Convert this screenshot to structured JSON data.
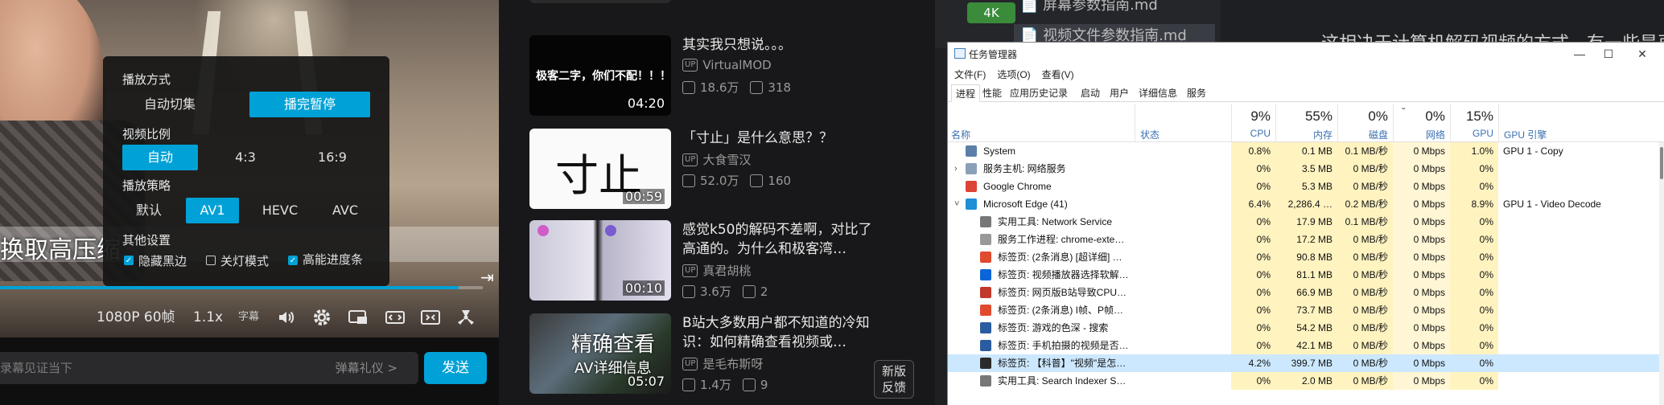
{
  "player": {
    "caption": "换取高压缩",
    "progress": 0.95,
    "controls": {
      "quality": "1080P 60帧",
      "speed": "1.1x",
      "subtitle": "字幕"
    },
    "danmaku": {
      "placeholder": "录幕见证当下",
      "etiquette": "弹幕礼仪 >",
      "send": "发送"
    },
    "settings": {
      "mode_title": "播放方式",
      "mode_options": [
        "自动切集",
        "播完暂停"
      ],
      "mode_selected": "播完暂停",
      "ratio_title": "视频比例",
      "ratio_options": [
        "自动",
        "4:3",
        "16:9"
      ],
      "ratio_selected": "自动",
      "strategy_title": "播放策略",
      "strategy_options": [
        "默认",
        "AV1",
        "HEVC",
        "AVC"
      ],
      "strategy_selected": "AV1",
      "other_title": "其他设置",
      "checks": [
        {
          "label": "隐藏黑边",
          "checked": true
        },
        {
          "label": "关灯模式",
          "checked": false
        },
        {
          "label": "高能进度条",
          "checked": true
        }
      ]
    }
  },
  "recommendations": [
    {
      "title": "其实我只想说。。。",
      "up": "VirtualMOD",
      "views": "18.6万",
      "danmaku": "318",
      "duration": "04:20",
      "thumb_text": "极客二字，你们不配！！！"
    },
    {
      "title": "「寸止」是什么意思？？",
      "up": "大食雪汉",
      "views": "52.0万",
      "danmaku": "160",
      "duration": "00:59",
      "thumb_text": "寸止"
    },
    {
      "title": "感觉k50的解码不差啊，对比了高通的。为什么和极客湾…",
      "up": "真君胡桃",
      "views": "3.6万",
      "danmaku": "2",
      "duration": "00:10",
      "thumb_text": ""
    },
    {
      "title": "B站大多数用户都不知道的冷知识：如何精确查看视频或…",
      "up": "是毛布斯呀",
      "views": "1.4万",
      "danmaku": "9",
      "duration": "05:07",
      "thumb_text": "精确查看",
      "thumb_sub": "AV详细信息"
    }
  ],
  "up_tag": "UP",
  "feedback": [
    "新版",
    "反馈"
  ],
  "editor": {
    "badge": "4K",
    "files": [
      "屏幕参数指南.md",
      "视频文件参数指南.md"
    ],
    "doc_text": "这相决于计算机解码视频的方式，有一些是再"
  },
  "task_manager": {
    "title": "任务管理器",
    "window_buttons": [
      "—",
      "☐",
      "✕"
    ],
    "menu": [
      "文件(F)",
      "选项(O)",
      "查看(V)"
    ],
    "tabs": [
      "进程",
      "性能",
      "应用历史记录",
      "启动",
      "用户",
      "详细信息",
      "服务"
    ],
    "active_tab": "进程",
    "header": {
      "name": "名称",
      "status": "状态",
      "cpu_pct": "9%",
      "cpu": "CPU",
      "mem_pct": "55%",
      "mem": "内存",
      "disk_pct": "0%",
      "disk": "磁盘",
      "net_pct": "0%",
      "net": "网络",
      "gpu_pct": "15%",
      "gpu": "GPU",
      "gpu_engine": "GPU 引擎",
      "sort_arrow": "ˇ"
    },
    "rows": [
      {
        "name": "System",
        "cpu": "0.8%",
        "mem": "0.1 MB",
        "disk": "0.1 MB/秒",
        "net": "0 Mbps",
        "gpu": "1.0%",
        "engine": "GPU 1 - Copy",
        "indent": 0,
        "expand": "",
        "icon": "system-icon",
        "icolor": "#5b7fa8"
      },
      {
        "name": "服务主机: 网络服务",
        "cpu": "0%",
        "mem": "3.5 MB",
        "disk": "0 MB/秒",
        "net": "0 Mbps",
        "gpu": "0%",
        "engine": "",
        "indent": 0,
        "expand": "›",
        "icon": "service-host-icon",
        "icolor": "#8aa0b8"
      },
      {
        "name": "Google Chrome",
        "cpu": "0%",
        "mem": "5.3 MB",
        "disk": "0 MB/秒",
        "net": "0 Mbps",
        "gpu": "0%",
        "engine": "",
        "indent": 0,
        "expand": "",
        "icon": "chrome-icon",
        "icolor": "#db4437"
      },
      {
        "name": "Microsoft Edge (41)",
        "cpu": "6.4%",
        "mem": "2,286.4 …",
        "disk": "0.2 MB/秒",
        "net": "0 Mbps",
        "gpu": "8.9%",
        "engine": "GPU 1 - Video Decode",
        "indent": 0,
        "expand": "˅",
        "icon": "edge-icon",
        "icolor": "#1e8fd6"
      },
      {
        "name": "实用工具: Network Service",
        "cpu": "0%",
        "mem": "17.9 MB",
        "disk": "0.1 MB/秒",
        "net": "0 Mbps",
        "gpu": "0%",
        "engine": "",
        "indent": 1,
        "expand": "",
        "icon": "utility-icon",
        "icolor": "#777"
      },
      {
        "name": "服务工作进程: chrome-exte…",
        "cpu": "0%",
        "mem": "17.2 MB",
        "disk": "0 MB/秒",
        "net": "0 Mbps",
        "gpu": "0%",
        "engine": "",
        "indent": 1,
        "expand": "",
        "icon": "document-icon",
        "icolor": "#999"
      },
      {
        "name": "标签页: (2条消息) [超详细] …",
        "cpu": "0%",
        "mem": "90.8 MB",
        "disk": "0 MB/秒",
        "net": "0 Mbps",
        "gpu": "0%",
        "engine": "",
        "indent": 1,
        "expand": "",
        "icon": "csdn-icon",
        "icolor": "#e04a2f"
      },
      {
        "name": "标签页: 视频播放器选择软解…",
        "cpu": "0%",
        "mem": "81.1 MB",
        "disk": "0 MB/秒",
        "net": "0 Mbps",
        "gpu": "0%",
        "engine": "",
        "indent": 1,
        "expand": "",
        "icon": "zhihu-icon",
        "icolor": "#0a66d8"
      },
      {
        "name": "标签页: 网页版B站导致CPU…",
        "cpu": "0%",
        "mem": "66.9 MB",
        "disk": "0 MB/秒",
        "net": "0 Mbps",
        "gpu": "0%",
        "engine": "",
        "indent": 1,
        "expand": "",
        "icon": "page-icon",
        "icolor": "#c0392b"
      },
      {
        "name": "标签页: (2条消息) I帧、P帧…",
        "cpu": "0%",
        "mem": "73.7 MB",
        "disk": "0 MB/秒",
        "net": "0 Mbps",
        "gpu": "0%",
        "engine": "",
        "indent": 1,
        "expand": "",
        "icon": "csdn-icon",
        "icolor": "#e04a2f"
      },
      {
        "name": "标签页: 游戏的色深 - 搜索",
        "cpu": "0%",
        "mem": "54.2 MB",
        "disk": "0 MB/秒",
        "net": "0 Mbps",
        "gpu": "0%",
        "engine": "",
        "indent": 1,
        "expand": "",
        "icon": "search-icon",
        "icolor": "#2a5d9f"
      },
      {
        "name": "标签页: 手机拍摄的视频是否…",
        "cpu": "0%",
        "mem": "42.1 MB",
        "disk": "0 MB/秒",
        "net": "0 Mbps",
        "gpu": "0%",
        "engine": "",
        "indent": 1,
        "expand": "",
        "icon": "search-icon",
        "icolor": "#2a5d9f"
      },
      {
        "name": "标签页: 【科普】\"视频\"是怎…",
        "cpu": "4.2%",
        "mem": "399.7 MB",
        "disk": "0 MB/秒",
        "net": "0 Mbps",
        "gpu": "0%",
        "engine": "",
        "indent": 1,
        "expand": "",
        "icon": "bilibili-icon",
        "icolor": "#2b2b2b",
        "selected": true
      },
      {
        "name": "实用工具: Search Indexer S…",
        "cpu": "0%",
        "mem": "2.0 MB",
        "disk": "0 MB/秒",
        "net": "0 Mbps",
        "gpu": "0%",
        "engine": "",
        "indent": 1,
        "expand": "",
        "icon": "utility-icon",
        "icolor": "#777"
      }
    ]
  }
}
